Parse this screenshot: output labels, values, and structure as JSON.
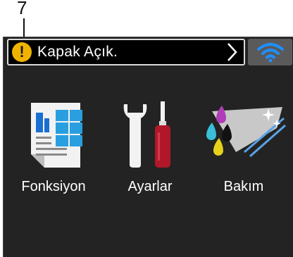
{
  "callout": {
    "number": "7"
  },
  "status_bar": {
    "message": "Kapak Açık.",
    "warning_icon": "exclamation-icon",
    "chevron_icon": "chevron-right-icon"
  },
  "wifi": {
    "icon": "wifi-icon",
    "color": "#1e8fff"
  },
  "tiles": [
    {
      "label": "Fonksiyon",
      "icon": "functions-icon"
    },
    {
      "label": "Ayarlar",
      "icon": "settings-tools-icon"
    },
    {
      "label": "Bakım",
      "icon": "maintenance-ink-icon"
    }
  ],
  "colors": {
    "screen_bg": "#232323",
    "warning": "#f0b400",
    "accent_blue": "#1e8fff",
    "tool_red": "#b0182a"
  }
}
